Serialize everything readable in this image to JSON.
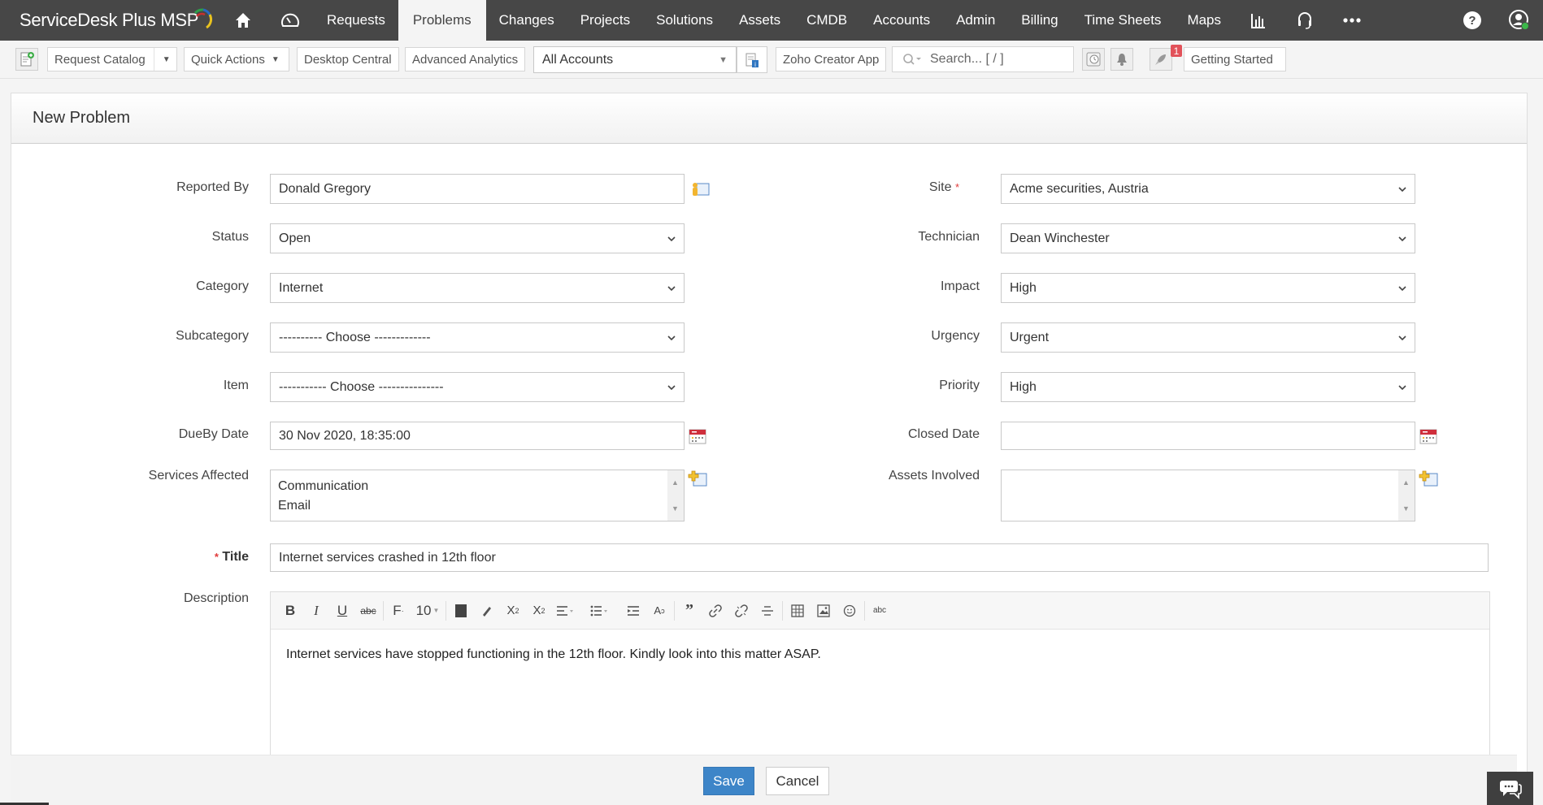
{
  "app": {
    "logo_text": "ServiceDesk Plus MSP",
    "accent_color": "#3d85c8",
    "nav_bg_color": "#474747"
  },
  "nav": {
    "items": [
      {
        "label": "Requests"
      },
      {
        "label": "Problems",
        "active": true
      },
      {
        "label": "Changes"
      },
      {
        "label": "Projects"
      },
      {
        "label": "Solutions"
      },
      {
        "label": "Assets"
      },
      {
        "label": "CMDB"
      },
      {
        "label": "Accounts"
      },
      {
        "label": "Admin"
      },
      {
        "label": "Billing"
      },
      {
        "label": "Time Sheets"
      },
      {
        "label": "Maps"
      }
    ],
    "icons": [
      "home-icon",
      "dashboard-icon",
      "reports-icon",
      "headset-icon",
      "more-icon",
      "help-icon",
      "user-profile-icon"
    ]
  },
  "toolbar": {
    "request_catalog": "Request Catalog",
    "quick_actions": "Quick Actions",
    "desktop_central": "Desktop Central",
    "advanced_analytics": "Advanced Analytics",
    "account_selected": "All Accounts",
    "zoho_creator": "Zoho Creator App",
    "search_placeholder": "Search... [ / ]",
    "notification_count": "1",
    "getting_started": "Getting Started"
  },
  "form": {
    "title": "New Problem",
    "left": {
      "reported_by": {
        "label": "Reported By",
        "value": "Donald Gregory"
      },
      "status": {
        "label": "Status",
        "value": "Open"
      },
      "category": {
        "label": "Category",
        "value": "Internet"
      },
      "subcategory": {
        "label": "Subcategory",
        "value": "---------- Choose -------------"
      },
      "item": {
        "label": "Item",
        "value": "----------- Choose ---------------"
      },
      "dueby": {
        "label": "DueBy Date",
        "value": "30 Nov 2020, 18:35:00"
      },
      "services": {
        "label": "Services Affected",
        "values": [
          "Communication",
          "Email"
        ]
      }
    },
    "right": {
      "site": {
        "label": "Site",
        "value": "Acme securities, Austria",
        "required": true
      },
      "technician": {
        "label": "Technician",
        "value": "Dean Winchester"
      },
      "impact": {
        "label": "Impact",
        "value": "High"
      },
      "urgency": {
        "label": "Urgency",
        "value": "Urgent"
      },
      "priority": {
        "label": "Priority",
        "value": "High"
      },
      "closed_date": {
        "label": "Closed Date",
        "value": ""
      },
      "assets": {
        "label": "Assets Involved",
        "values": []
      }
    },
    "title_field": {
      "label": "Title",
      "value": "Internet services crashed in 12th floor",
      "required": true
    },
    "description": {
      "label": "Description",
      "font_size": "10",
      "body": "Internet services have stopped functioning in the 12th floor. Kindly look into this matter ASAP."
    },
    "required_mark": "*"
  },
  "footer": {
    "save": "Save",
    "cancel": "Cancel"
  }
}
